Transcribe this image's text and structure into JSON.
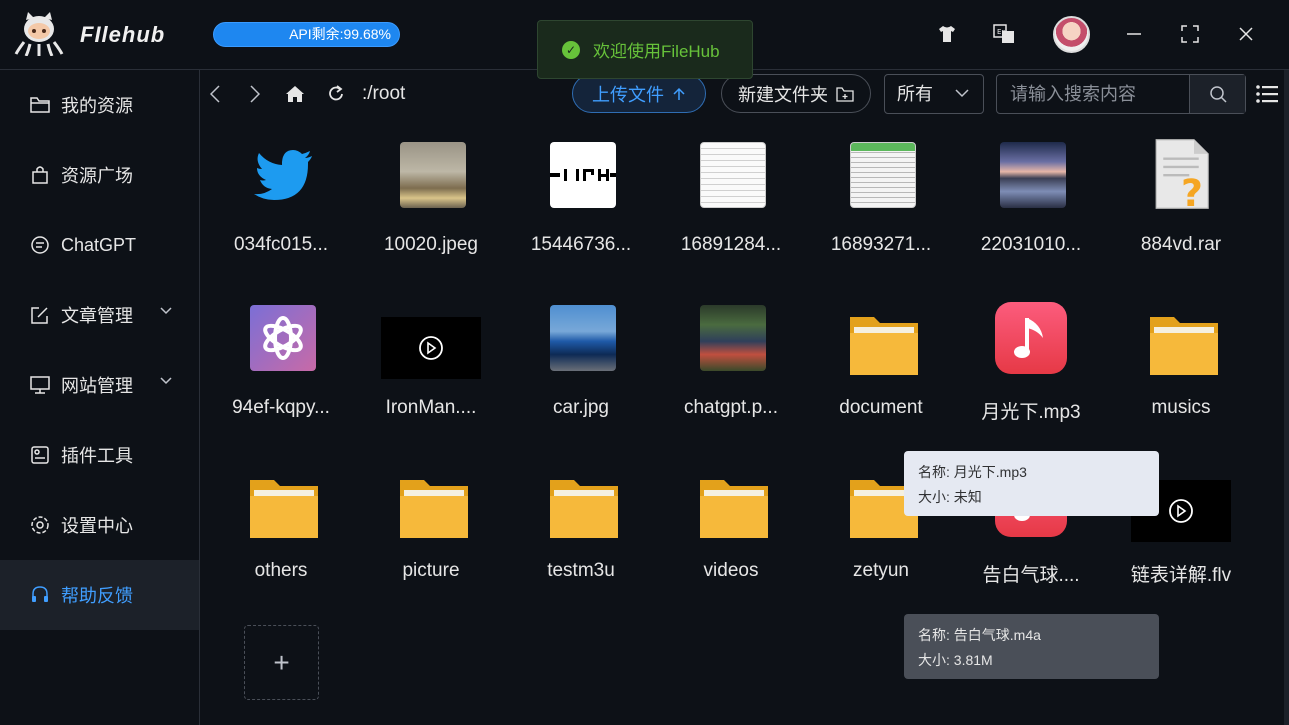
{
  "header": {
    "brand": "FIlehub",
    "api_status": "API剩余:99.68%",
    "toast": "欢迎使用FileHub"
  },
  "sidebar": {
    "items": [
      {
        "label": "我的资源",
        "icon": "folder-icon"
      },
      {
        "label": "资源广场",
        "icon": "bag-icon"
      },
      {
        "label": "ChatGPT",
        "icon": "chat-icon"
      },
      {
        "label": "文章管理",
        "icon": "edit-icon"
      },
      {
        "label": "网站管理",
        "icon": "monitor-icon"
      },
      {
        "label": "插件工具",
        "icon": "plugin-icon"
      },
      {
        "label": "设置中心",
        "icon": "gear-icon"
      },
      {
        "label": "帮助反馈",
        "icon": "headset-icon"
      }
    ]
  },
  "toolbar": {
    "path": ":/root",
    "upload_label": "上传文件",
    "new_folder_label": "新建文件夹",
    "filter_value": "所有",
    "search_placeholder": "请输入搜索内容"
  },
  "files": [
    {
      "name": "034fc015...",
      "kind": "twitter-image"
    },
    {
      "name": "10020.jpeg",
      "kind": "room-image"
    },
    {
      "name": "15446736...",
      "kind": "logo-image"
    },
    {
      "name": "16891284...",
      "kind": "screenshot-image"
    },
    {
      "name": "16893271...",
      "kind": "screenshot-image"
    },
    {
      "name": "22031010...",
      "kind": "landscape-image"
    },
    {
      "name": "884vd.rar",
      "kind": "unknown-file"
    },
    {
      "name": "94ef-kqpy...",
      "kind": "openai-image"
    },
    {
      "name": "IronMan....",
      "kind": "video"
    },
    {
      "name": "car.jpg",
      "kind": "car-image"
    },
    {
      "name": "chatgpt.p...",
      "kind": "desktop-image"
    },
    {
      "name": "document",
      "kind": "folder"
    },
    {
      "name": "月光下.mp3",
      "kind": "music"
    },
    {
      "name": "musics",
      "kind": "folder"
    },
    {
      "name": "others",
      "kind": "folder"
    },
    {
      "name": "picture",
      "kind": "folder"
    },
    {
      "name": "testm3u",
      "kind": "folder"
    },
    {
      "name": "videos",
      "kind": "folder"
    },
    {
      "name": "zetyun",
      "kind": "folder"
    },
    {
      "name": "告白气球....",
      "kind": "music"
    },
    {
      "name": "链表详解.flv",
      "kind": "video"
    }
  ],
  "tooltips": {
    "moonlight": {
      "name_line": "名称: 月光下.mp3",
      "size_line": "大小: 未知"
    },
    "balloon": {
      "name_line": "名称: 告白气球.m4a",
      "size_line": "大小: 3.81M"
    }
  },
  "add_label": "+",
  "colors": {
    "accent": "#409eff",
    "success": "#67c23a",
    "background": "#0d1117"
  }
}
